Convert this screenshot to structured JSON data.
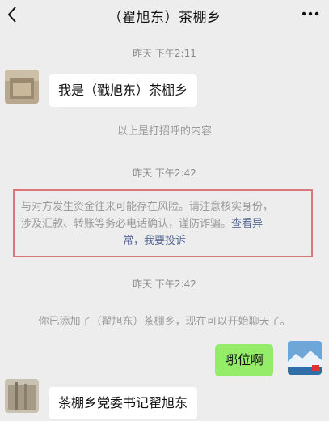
{
  "header": {
    "title": "（翟旭东）茶棚乡"
  },
  "messages": {
    "time1": "昨天 下午2:11",
    "bubble1": "我是（戳旭东）茶棚乡",
    "sys1": "以上是打招呼的内容",
    "time2": "昨天 下午2:42",
    "warning": {
      "line1": "与对方发生资金往来可能存在风险。请注意核实身份，",
      "line2_text": "涉及汇款、转账等务必电话确认，谨防诈骗。",
      "line2_link": "查看异",
      "line3_link1": "常",
      "line3_sep": "，",
      "line3_link2": "我要投诉"
    },
    "time3": "昨天 下午2:42",
    "sys2": "你已添加了（翟旭东）茶棚乡，现在可以开始聊天了。",
    "bubble2": "哪位啊",
    "bubble3": "茶棚乡党委书记翟旭东"
  },
  "icons": {
    "back": "back-chevron-icon",
    "more": "more-dots-icon"
  },
  "colors": {
    "background": "#ededed",
    "self_bubble": "#95ec69",
    "link": "#576b95",
    "highlight_border": "#d9777b"
  }
}
